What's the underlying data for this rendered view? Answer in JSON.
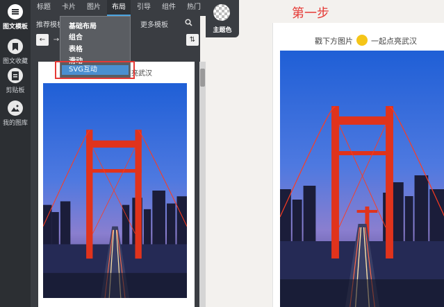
{
  "sidebar": {
    "items": [
      {
        "label": "图文模板",
        "icon": "menu-icon"
      },
      {
        "label": "图文收藏",
        "icon": "bookmark-icon"
      },
      {
        "label": "剪贴板",
        "icon": "clipboard-icon"
      },
      {
        "label": "我的图库",
        "icon": "image-icon"
      }
    ]
  },
  "tabs": [
    "标题",
    "卡片",
    "图片",
    "布局",
    "引导",
    "组件",
    "热门"
  ],
  "active_tab": "布局",
  "theme": {
    "label": "主题色"
  },
  "subtabs": {
    "left": "推荐模板",
    "right": "更多模板"
  },
  "dropdown": {
    "items": [
      "基础布局",
      "组合",
      "表格",
      "滑动",
      "SVG互动"
    ],
    "highlighted": "SVG互动"
  },
  "preview": {
    "caption": "起点亮武汉"
  },
  "right_page": {
    "step_title": "第一步",
    "caption_left": "戳下方图片",
    "caption_right": "一起点亮武汉"
  },
  "colors": {
    "accent": "#4aa3df",
    "highlight_box": "#e53935",
    "dot": "#f5c518"
  }
}
